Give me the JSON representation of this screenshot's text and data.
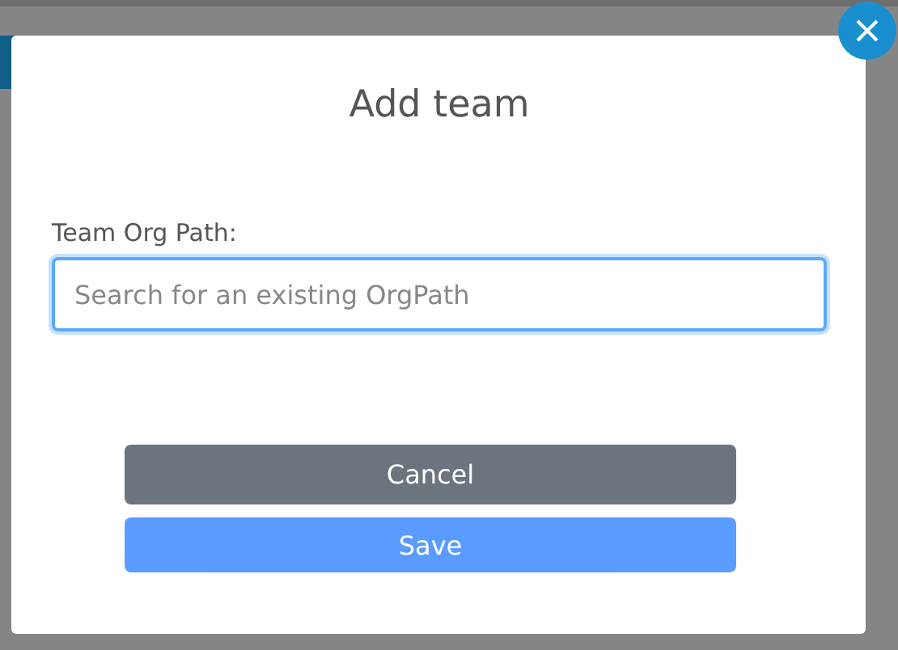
{
  "dialog": {
    "title": "Add team",
    "field": {
      "label": "Team Org Path:",
      "placeholder": "Search for an existing OrgPath",
      "focused": true
    },
    "buttons": [
      {
        "label": "Cancel",
        "kind": "secondary",
        "disabled": false
      },
      {
        "label": "Save",
        "kind": "primary",
        "disabled": true
      }
    ]
  }
}
